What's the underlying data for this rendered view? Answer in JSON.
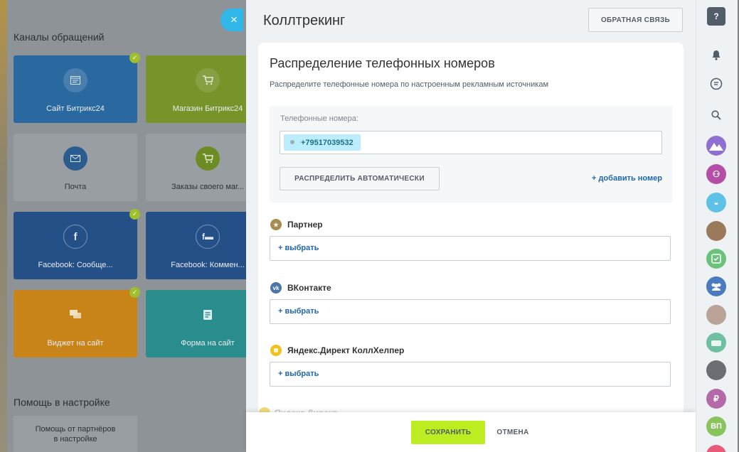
{
  "background": {
    "section_title": "Каналы обращений",
    "tiles": [
      {
        "label": "Сайт Битрикс24",
        "icon": "window-icon",
        "checked": true
      },
      {
        "label": "Магазин Битрикс24",
        "icon": "cart-icon",
        "checked": true
      },
      {
        "label": "Почта",
        "icon": "mail-icon",
        "checked": false
      },
      {
        "label": "Заказы своего маг...",
        "icon": "cart-icon",
        "checked": false
      },
      {
        "label": "Facebook: Сообще...",
        "icon": "facebook-icon",
        "checked": true
      },
      {
        "label": "Facebook: Коммен...",
        "icon": "facebook-comments-icon",
        "checked": false
      },
      {
        "label": "Виджет на сайт",
        "icon": "chat-icon",
        "checked": true
      },
      {
        "label": "Форма на сайт",
        "icon": "form-icon",
        "checked": false
      }
    ],
    "help_title": "Помощь в настройке",
    "help_tile_line1": "Помощь от партнёров",
    "help_tile_line2": "в настройке"
  },
  "close_button": "×",
  "slider": {
    "title": "Коллтрекинг",
    "feedback_label": "ОБРАТНАЯ СВЯЗЬ",
    "card": {
      "title": "Распределение телефонных номеров",
      "description": "Распределите телефонные номера по настроенным рекламным источникам",
      "numbers_label": "Телефонные номера:",
      "phone_numbers": [
        "+79517039532"
      ],
      "auto_button": "РАСПРЕДЕЛИТЬ АВТОМАТИЧЕСКИ",
      "add_number": "+ добавить номер",
      "sources": [
        {
          "name": "Партнер",
          "icon": "star-icon",
          "color": "#a88b4e",
          "select_label": "+ выбрать"
        },
        {
          "name": "ВКонтакте",
          "icon": "vk-icon",
          "color": "#4a76a8",
          "select_label": "+ выбрать"
        },
        {
          "name": "Яндекс.Директ КоллХелпер",
          "icon": "yandex-icon",
          "color": "#f2c21b",
          "select_label": "+ выбрать"
        }
      ],
      "partial_source": "Яндекс.Директ"
    },
    "footer": {
      "save": "СОХРАНИТЬ",
      "cancel": "ОТМЕНА"
    }
  },
  "rightbar": {
    "help": "?",
    "avatar_initials": "ВП",
    "ruble": "₽"
  }
}
